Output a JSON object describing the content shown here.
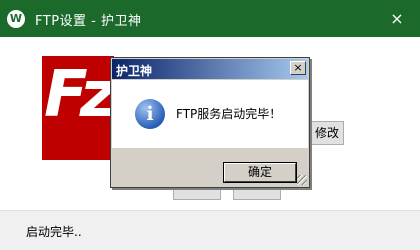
{
  "window": {
    "title": "FTP设置 - 护卫神",
    "app_icon": "W",
    "close_icon": "×"
  },
  "main": {
    "modify_button": "修改",
    "status_text": "启动完毕.."
  },
  "dialog": {
    "title": "护卫神",
    "close_icon": "×",
    "message": "FTP服务启动完毕！",
    "ok_button": "确定",
    "icon": "info-icon"
  },
  "colors": {
    "titlebar": "#1b6a2c",
    "logo_red": "#bf0000",
    "dialog_title_start": "#0a246a",
    "dialog_title_end": "#a6caf0"
  }
}
